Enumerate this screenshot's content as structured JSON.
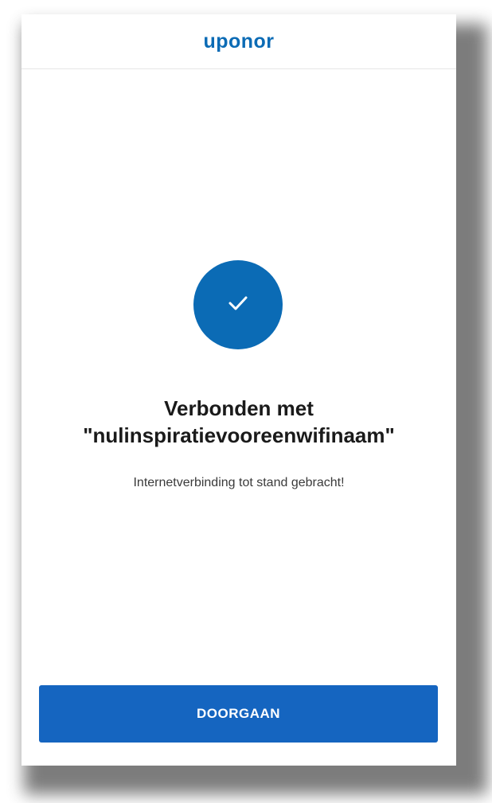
{
  "header": {
    "logo_text": "uponor"
  },
  "status": {
    "icon": "check-icon",
    "title_line1": "Verbonden met",
    "title_line2": "\"nulinspiratievooreenwifinaam\"",
    "message": "Internetverbinding tot stand gebracht!"
  },
  "actions": {
    "continue_label": "DOORGAAN"
  },
  "colors": {
    "brand": "#0b6bb5",
    "button": "#1565c0",
    "text": "#1a1a1a"
  }
}
